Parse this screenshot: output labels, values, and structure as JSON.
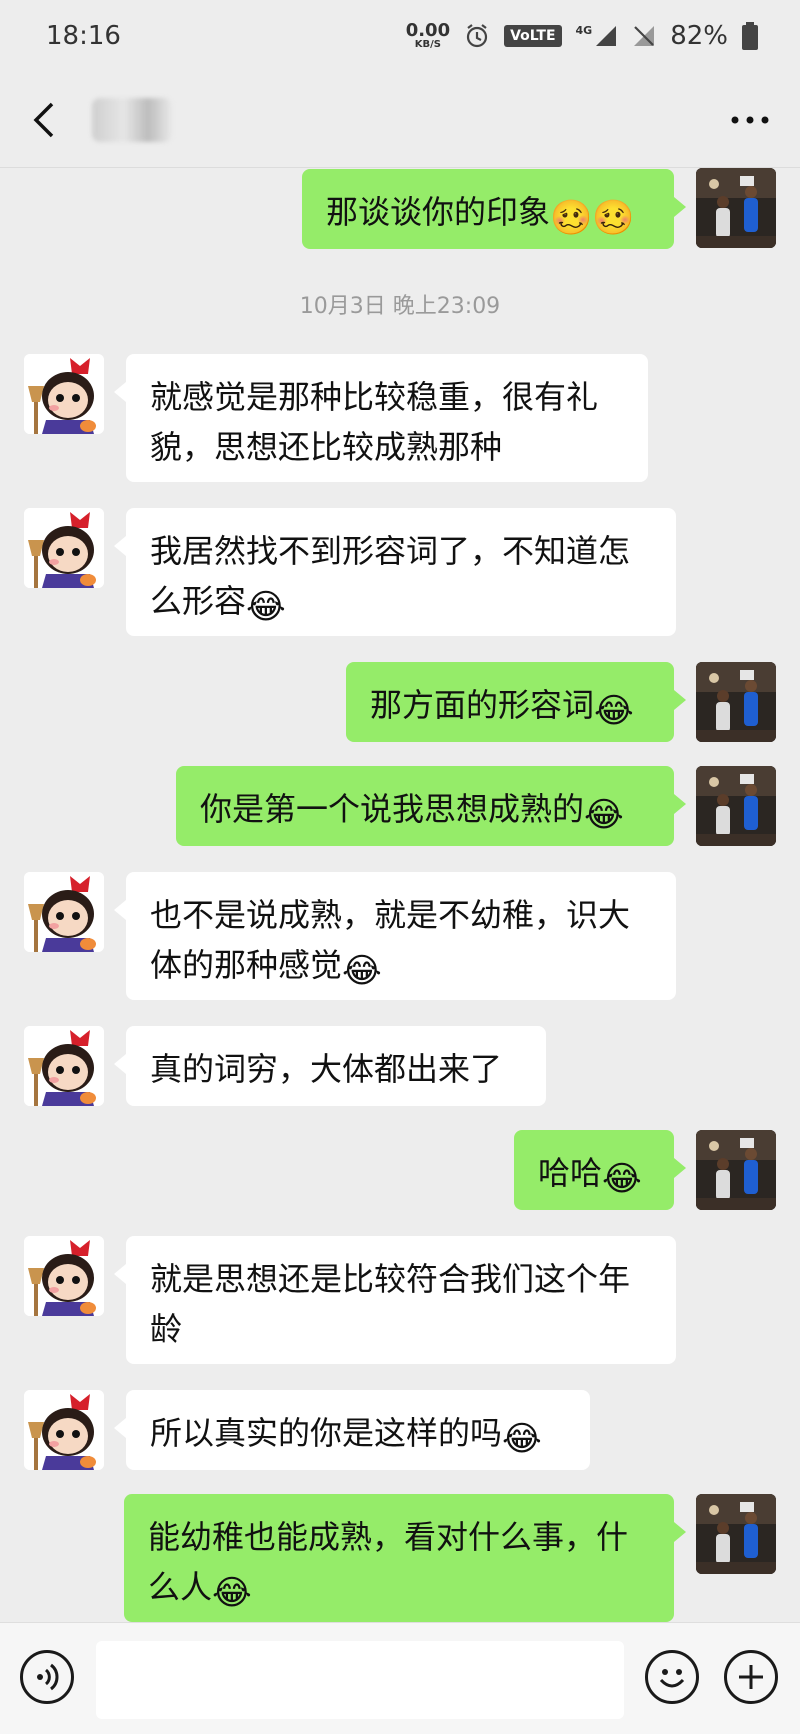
{
  "statusbar": {
    "time": "18:16",
    "net_speed": "0.00",
    "net_unit": "KB/S",
    "volte": "VoLTE",
    "network": "4G",
    "battery": "82%"
  },
  "navbar": {
    "back_icon": "chevron-left-icon",
    "more_icon": "more-dots-icon"
  },
  "chat": {
    "timestamp": "10月3日 晚上23:09",
    "messages": [
      {
        "from": "me",
        "text": "那谈谈你的印象",
        "emoji": "🥴🥴"
      },
      {
        "from": "them",
        "text": "就感觉是那种比较稳重，很有礼貌，思想还比较成熟那种",
        "emoji": ""
      },
      {
        "from": "them",
        "text": "我居然找不到形容词了，不知道怎么形容",
        "emoji": "😂"
      },
      {
        "from": "me",
        "text": "那方面的形容词",
        "emoji": "😂"
      },
      {
        "from": "me",
        "text": "你是第一个说我思想成熟的",
        "emoji": "😂"
      },
      {
        "from": "them",
        "text": "也不是说成熟，就是不幼稚，识大体的那种感觉",
        "emoji": "😂"
      },
      {
        "from": "them",
        "text": "真的词穷，大体都出来了",
        "emoji": ""
      },
      {
        "from": "me",
        "text": "哈哈",
        "emoji": "😂"
      },
      {
        "from": "them",
        "text": "就是思想还是比较符合我们这个年龄",
        "emoji": ""
      },
      {
        "from": "them",
        "text": "所以真实的你是这样的吗",
        "emoji": "😂"
      },
      {
        "from": "me",
        "text": "能幼稚也能成熟，看对什么事，什么人",
        "emoji": "😂"
      }
    ]
  },
  "inputbar": {
    "voice_icon": "voice-icon",
    "emoji_icon": "smiley-icon",
    "add_icon": "plus-icon",
    "input_value": ""
  },
  "colors": {
    "background": "#ededed",
    "my_bubble": "#95ec69",
    "their_bubble": "#ffffff"
  }
}
